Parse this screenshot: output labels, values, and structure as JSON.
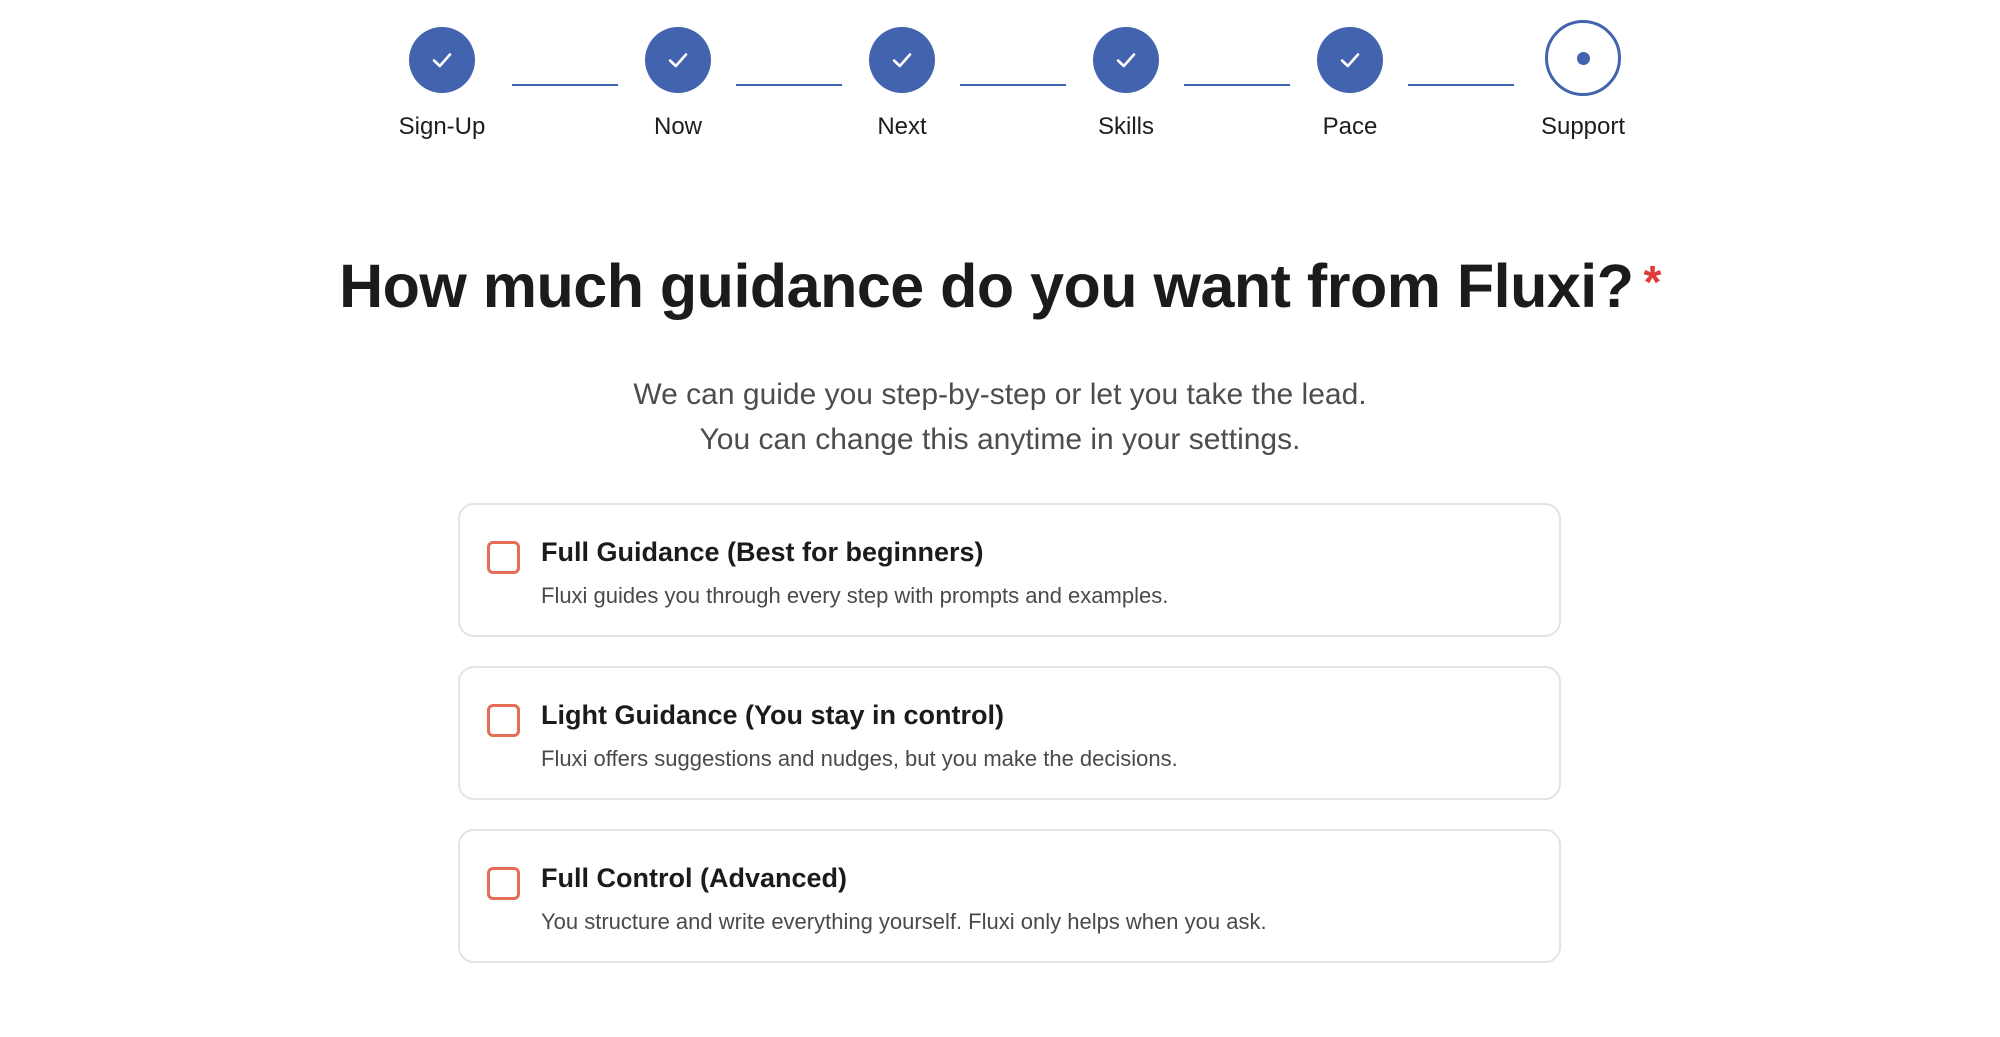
{
  "stepper": {
    "steps": [
      {
        "label": "Sign-Up",
        "state": "complete",
        "icon": "checkmark-icon"
      },
      {
        "label": "Now",
        "state": "complete",
        "icon": "checkmark-icon"
      },
      {
        "label": "Next",
        "state": "complete",
        "icon": "checkmark-icon"
      },
      {
        "label": "Skills",
        "state": "complete",
        "icon": "checkmark-icon"
      },
      {
        "label": "Pace",
        "state": "complete",
        "icon": "checkmark-icon"
      },
      {
        "label": "Support",
        "state": "current",
        "icon": "dot-icon"
      }
    ]
  },
  "question": {
    "title": "How much guidance do you want from Fluxi?",
    "required_mark": "*",
    "description_line1": "We can guide you step-by-step or let you take the lead.",
    "description_line2": "You can change this anytime in your settings."
  },
  "options": [
    {
      "title": "Full Guidance (Best for beginners)",
      "description": "Fluxi guides you through every step with prompts and examples.",
      "checked": false
    },
    {
      "title": "Light Guidance (You stay in control)",
      "description": "Fluxi offers suggestions and nudges, but you make the decisions.",
      "checked": false
    },
    {
      "title": "Full Control (Advanced)",
      "description": "You structure and write everything yourself. Fluxi only helps when you ask.",
      "checked": false
    }
  ],
  "colors": {
    "accent": "#4263ae",
    "checkbox_border": "#e46f56",
    "required": "#e03c3c",
    "card_border": "#e4e4e4"
  }
}
